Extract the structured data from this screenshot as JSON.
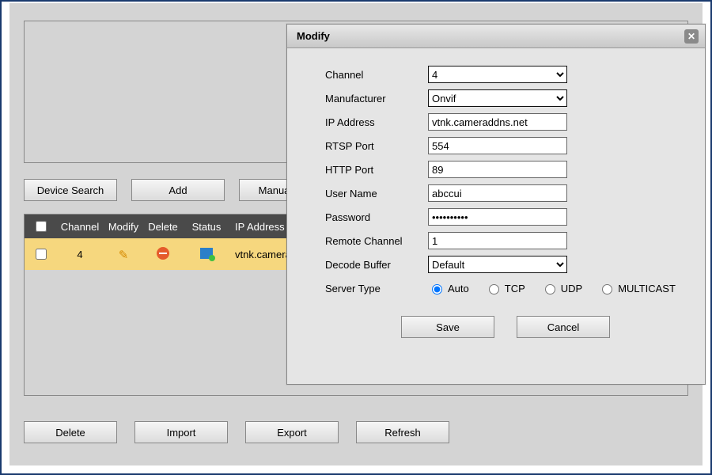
{
  "toolbar1": {
    "device_search": "Device Search",
    "add": "Add",
    "manual_add": "Manual Add"
  },
  "table": {
    "headers": {
      "channel": "Channel",
      "modify": "Modify",
      "delete": "Delete",
      "status": "Status",
      "ip": "IP Address"
    },
    "rows": [
      {
        "channel": "4",
        "ip": "vtnk.cameraddns.net"
      }
    ]
  },
  "toolbar2": {
    "delete": "Delete",
    "import": "Import",
    "export": "Export",
    "refresh": "Refresh"
  },
  "dialog": {
    "title": "Modify",
    "labels": {
      "channel": "Channel",
      "manufacturer": "Manufacturer",
      "ip": "IP Address",
      "rtsp": "RTSP Port",
      "http": "HTTP Port",
      "user": "User Name",
      "password": "Password",
      "remote": "Remote Channel",
      "decode": "Decode Buffer",
      "server": "Server Type"
    },
    "values": {
      "channel": "4",
      "manufacturer": "Onvif",
      "ip": "vtnk.cameraddns.net",
      "rtsp": "554",
      "http": "89",
      "user": "abccui",
      "password": "••••••••••",
      "remote": "1",
      "decode": "Default"
    },
    "server_options": {
      "auto": "Auto",
      "tcp": "TCP",
      "udp": "UDP",
      "multicast": "MULTICAST"
    },
    "server_selected": "auto",
    "buttons": {
      "save": "Save",
      "cancel": "Cancel"
    }
  }
}
